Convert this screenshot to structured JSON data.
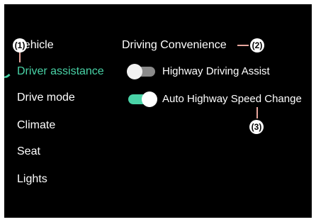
{
  "sidebar": {
    "items": [
      {
        "label": "Vehicle"
      },
      {
        "label": "Driver assistance"
      },
      {
        "label": "Drive mode"
      },
      {
        "label": "Climate"
      },
      {
        "label": "Seat"
      },
      {
        "label": "Lights"
      }
    ],
    "active_index": 1
  },
  "main": {
    "section_title": "Driving Convenience",
    "settings": [
      {
        "label": "Highway Driving Assist",
        "enabled": false
      },
      {
        "label": "Auto Highway Speed Change",
        "enabled": true
      }
    ]
  },
  "callouts": [
    {
      "label": "(1)"
    },
    {
      "label": "(2)"
    },
    {
      "label": "(3)"
    }
  ],
  "colors": {
    "background": "#000000",
    "accent": "#49d3a7",
    "text": "#ffffff",
    "toggle_off": "#8a8a8a",
    "leader_line": "#e8a69d"
  }
}
